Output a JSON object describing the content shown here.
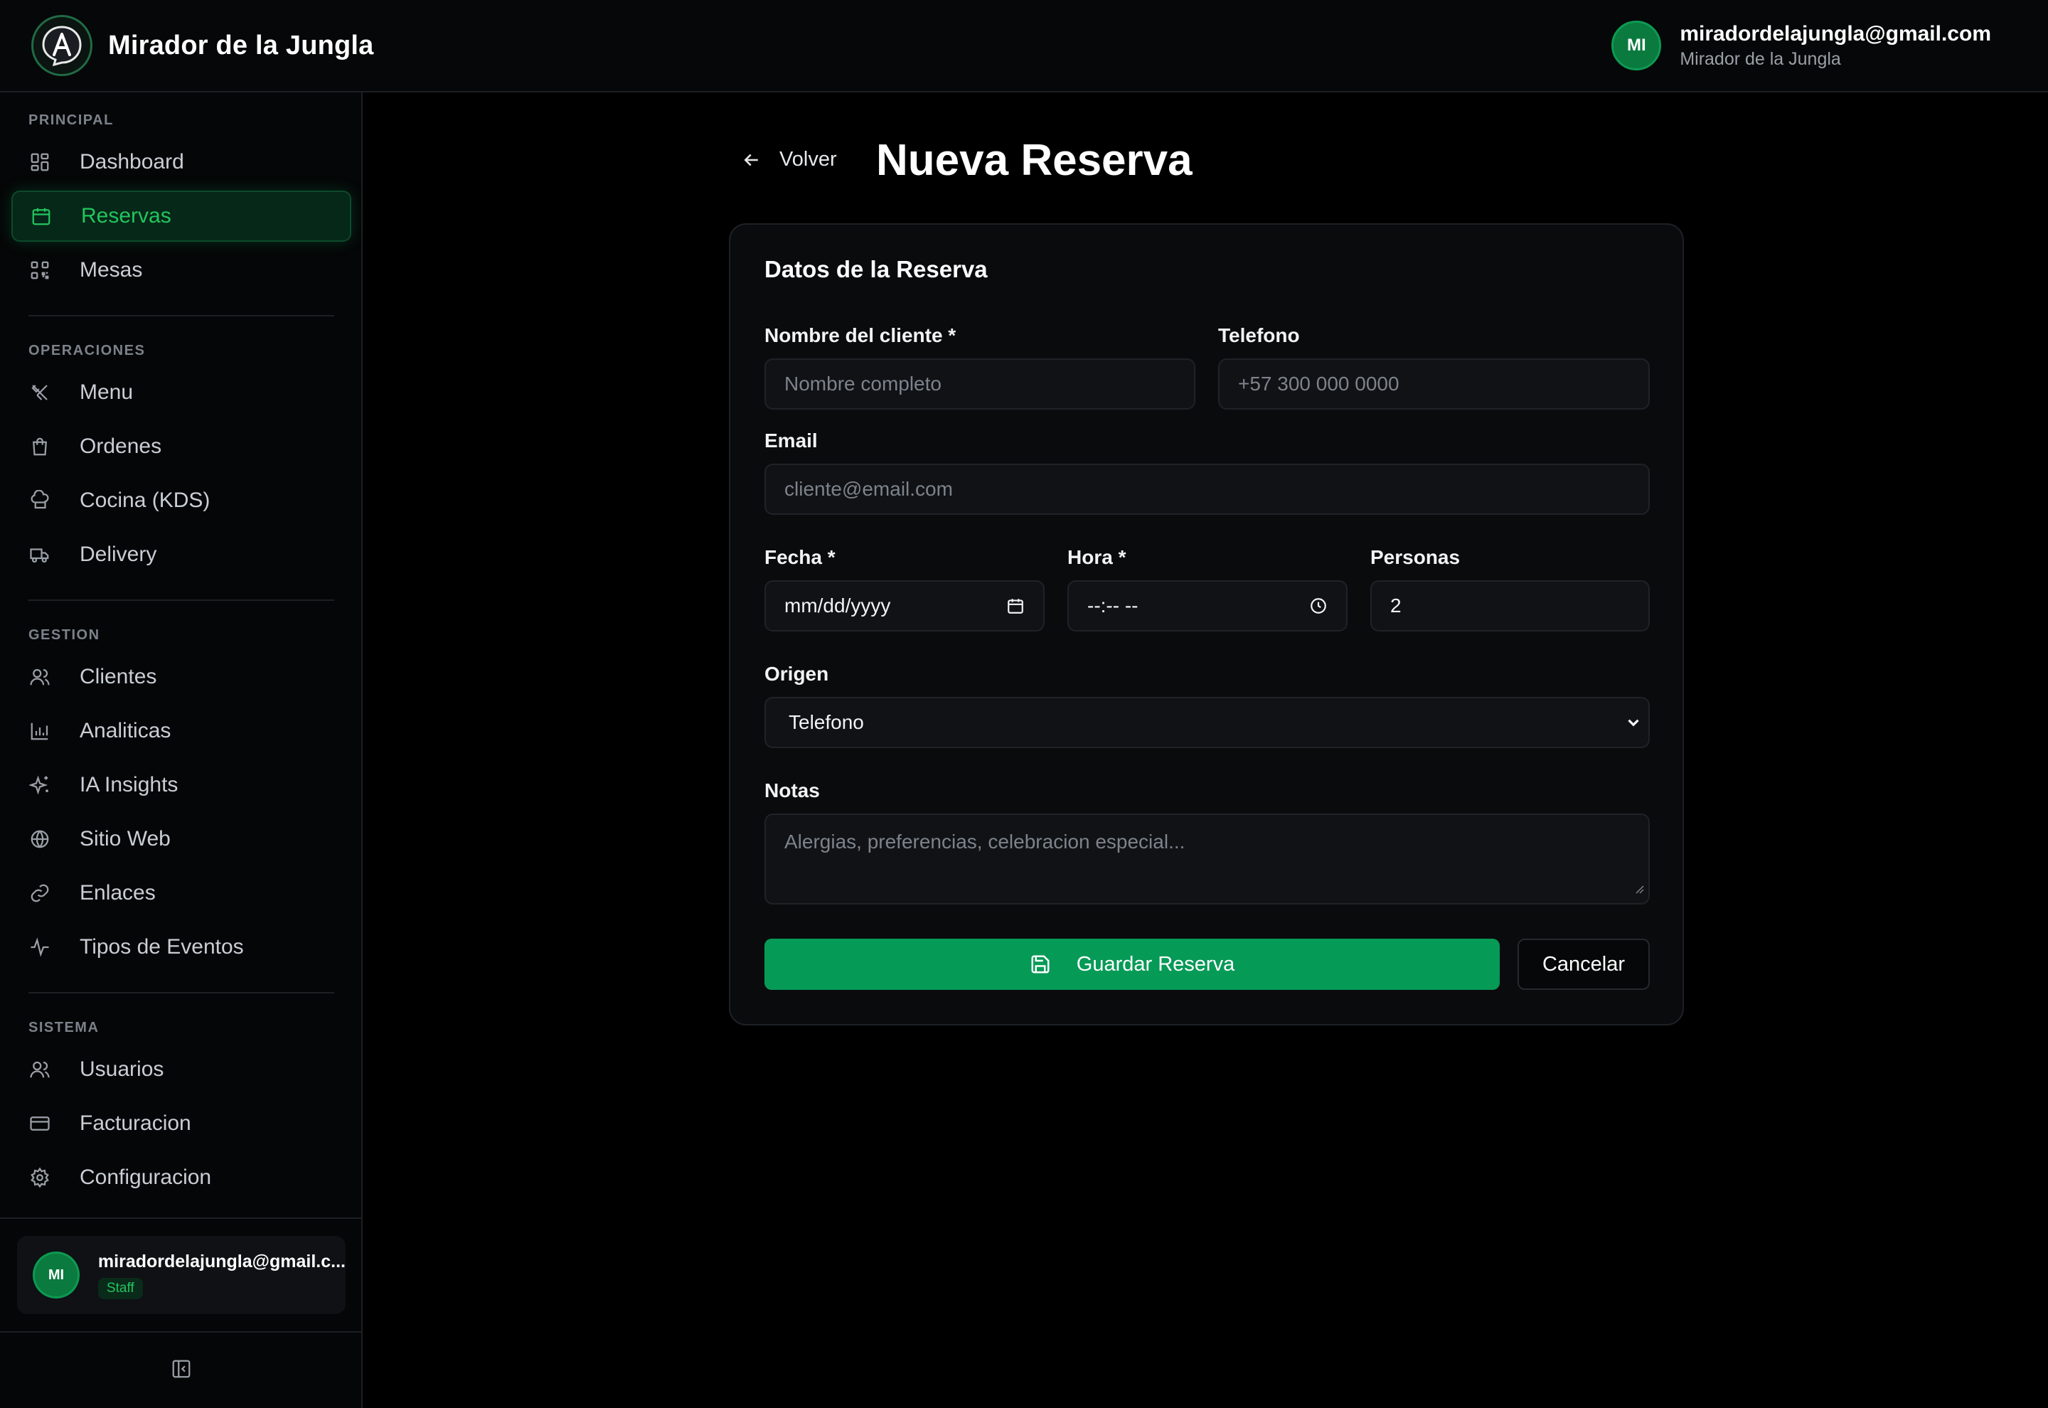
{
  "app": {
    "brand_name": "Mirador de la Jungla",
    "accent_color": "#069a57"
  },
  "topbar": {
    "user_initials": "MI",
    "user_email": "miradordelajungla@gmail.com",
    "user_org": "Mirador de la Jungla"
  },
  "sidebar": {
    "sections": [
      {
        "label": "PRINCIPAL"
      },
      {
        "label": "OPERACIONES"
      },
      {
        "label": "GESTION"
      },
      {
        "label": "SISTEMA"
      }
    ],
    "items": [
      {
        "label": "Dashboard",
        "icon": "dashboard-icon"
      },
      {
        "label": "Reservas",
        "icon": "calendar-icon",
        "active": true
      },
      {
        "label": "Mesas",
        "icon": "qr-icon"
      },
      {
        "label": "Menu",
        "icon": "utensils-icon"
      },
      {
        "label": "Ordenes",
        "icon": "bag-icon"
      },
      {
        "label": "Cocina (KDS)",
        "icon": "chef-hat-icon"
      },
      {
        "label": "Delivery",
        "icon": "truck-icon"
      },
      {
        "label": "Clientes",
        "icon": "users-icon"
      },
      {
        "label": "Analiticas",
        "icon": "bar-chart-icon"
      },
      {
        "label": "IA Insights",
        "icon": "sparkles-icon"
      },
      {
        "label": "Sitio Web",
        "icon": "globe-icon"
      },
      {
        "label": "Enlaces",
        "icon": "link-icon"
      },
      {
        "label": "Tipos de Eventos",
        "icon": "activity-icon"
      },
      {
        "label": "Usuarios",
        "icon": "users-icon"
      },
      {
        "label": "Facturacion",
        "icon": "credit-card-icon"
      },
      {
        "label": "Configuracion",
        "icon": "settings-icon"
      }
    ],
    "user": {
      "initials": "MI",
      "email": "miradordelajungla@gmail.c...",
      "role": "Staff"
    }
  },
  "page": {
    "back_label": "Volver",
    "title": "Nueva Reserva"
  },
  "form": {
    "card_title": "Datos de la Reserva",
    "nombre": {
      "label": "Nombre del cliente *",
      "placeholder": "Nombre completo"
    },
    "telefono": {
      "label": "Telefono",
      "placeholder": "+57 300 000 0000"
    },
    "email": {
      "label": "Email",
      "placeholder": "cliente@email.com"
    },
    "fecha": {
      "label": "Fecha *",
      "value": "mm/dd/yyyy"
    },
    "hora": {
      "label": "Hora *",
      "value": "--:-- --"
    },
    "personas": {
      "label": "Personas",
      "value": "2"
    },
    "origen": {
      "label": "Origen",
      "value": "Telefono"
    },
    "notas": {
      "label": "Notas",
      "placeholder": "Alergias, preferencias, celebracion especial..."
    },
    "submit_label": "Guardar Reserva",
    "cancel_label": "Cancelar"
  }
}
